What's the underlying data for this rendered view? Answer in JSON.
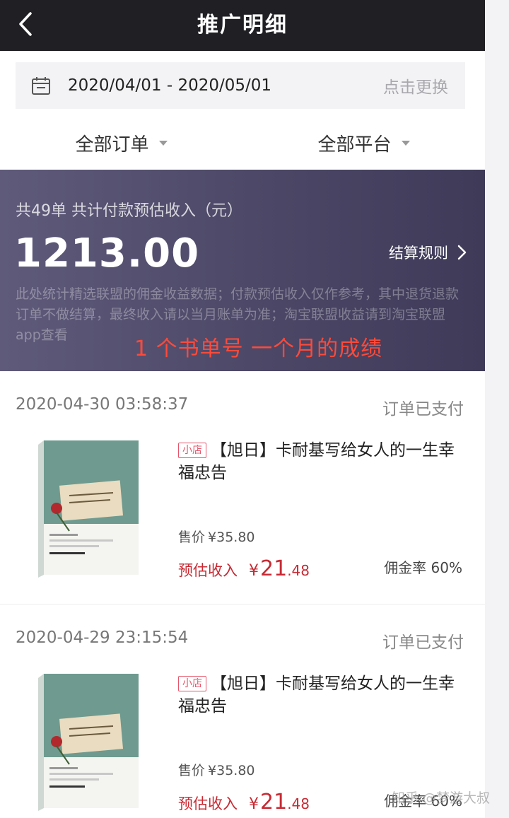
{
  "header": {
    "title": "推广明细"
  },
  "datebar": {
    "range": "2020/04/01 - 2020/05/01",
    "change_label": "点击更换"
  },
  "filters": [
    {
      "label": "全部订单"
    },
    {
      "label": "全部平台"
    }
  ],
  "summary": {
    "count_line": "共49单 共计付款预估收入（元）",
    "amount": "1213.00",
    "rules_label": "结算规则",
    "note": "此处统计精选联盟的佣金收益数据；付款预估收入仅作参考，其中退货退款订单不做结算，最终收入请以当月账单为准；淘宝联盟收益请到淘宝联盟app查看",
    "overlay": "1 个书单号  一个月的成绩"
  },
  "orders": [
    {
      "time": "2020-04-30 03:58:37",
      "status": "订单已支付",
      "shop_tag": "小店",
      "title": "【旭日】卡耐基写给女人的一生幸福忠告",
      "price_label": "售价",
      "price": "¥35.80",
      "income_label": "预估收入",
      "income_yen": "¥",
      "income_int": "21",
      "income_dec": ".48",
      "commission": "佣金率 60%"
    },
    {
      "time": "2020-04-29 23:15:54",
      "status": "订单已支付",
      "shop_tag": "小店",
      "title": "【旭日】卡耐基写给女人的一生幸福忠告",
      "price_label": "售价",
      "price": "¥35.80",
      "income_label": "预估收入",
      "income_yen": "¥",
      "income_int": "21",
      "income_dec": ".48",
      "commission": "佣金率 60%"
    }
  ],
  "watermark": "知乎 @梦游大叔",
  "colors": {
    "header_bg": "#1f1f24",
    "summary_bg": "#4c4766",
    "income_red": "#c82a33",
    "tag_pink": "#e5566b",
    "overlay_red": "#ff4a3a"
  }
}
